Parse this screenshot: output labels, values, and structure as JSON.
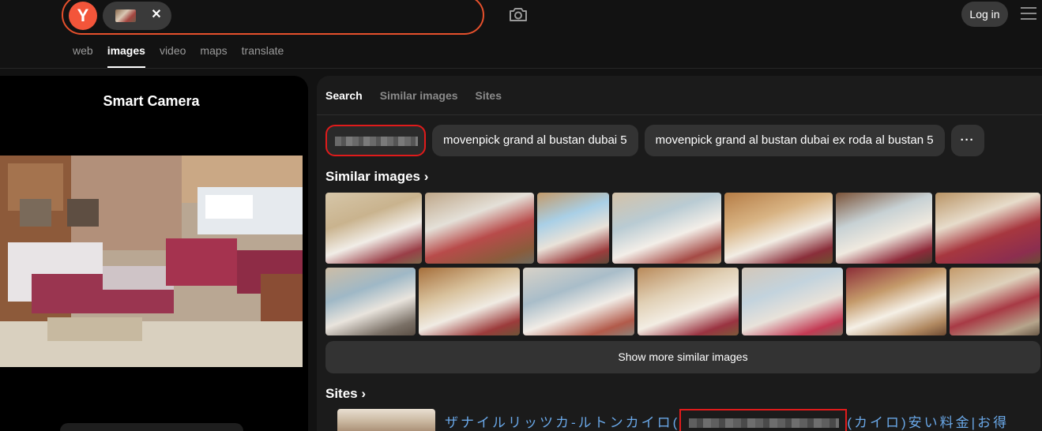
{
  "header": {
    "logo_letter": "Y",
    "login_label": "Log in"
  },
  "nav_tabs": [
    "web",
    "images",
    "video",
    "maps",
    "translate"
  ],
  "left_panel": {
    "title": "Smart Camera"
  },
  "right_panel": {
    "tabs": [
      "Search",
      "Similar images",
      "Sites"
    ],
    "query_chips": [
      "movenpick grand al bustan dubai 5",
      "movenpick grand al bustan dubai ex roda al bustan 5"
    ],
    "more_label": "···",
    "similar_title": "Similar images ›",
    "show_more_label": "Show more similar images",
    "sites_title": "Sites ›",
    "site_result": {
      "title_before": "ザナイルリッツカ-ルトンカイロ(",
      "title_after": "(カイロ)安い料金|お得"
    }
  },
  "colors": {
    "accent": "#f3553a",
    "link": "#6aa8e8",
    "redact_border": "#e01b1b"
  }
}
